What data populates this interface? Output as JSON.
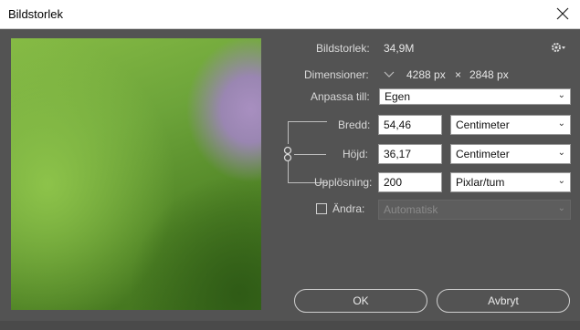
{
  "window": {
    "title": "Bildstorlek"
  },
  "info": {
    "size_label": "Bildstorlek:",
    "size_value": "34,9M",
    "dimensions_label": "Dimensioner:",
    "width_px": "4288 px",
    "times": "×",
    "height_px": "2848 px"
  },
  "fit": {
    "label": "Anpassa till:",
    "value": "Egen"
  },
  "width": {
    "label": "Bredd:",
    "value": "54,46",
    "unit": "Centimeter"
  },
  "height": {
    "label": "Höjd:",
    "value": "36,17",
    "unit": "Centimeter"
  },
  "resolution": {
    "label": "Upplösning:",
    "value": "200",
    "unit": "Pixlar/tum"
  },
  "resample": {
    "label": "Ändra:",
    "value": "Automatisk",
    "checked": false
  },
  "buttons": {
    "ok": "OK",
    "cancel": "Avbryt"
  },
  "icons": {
    "gear": "gear-icon",
    "link": "chain-link-icon",
    "chevron": "chevron-down-icon",
    "close": "close-icon"
  }
}
